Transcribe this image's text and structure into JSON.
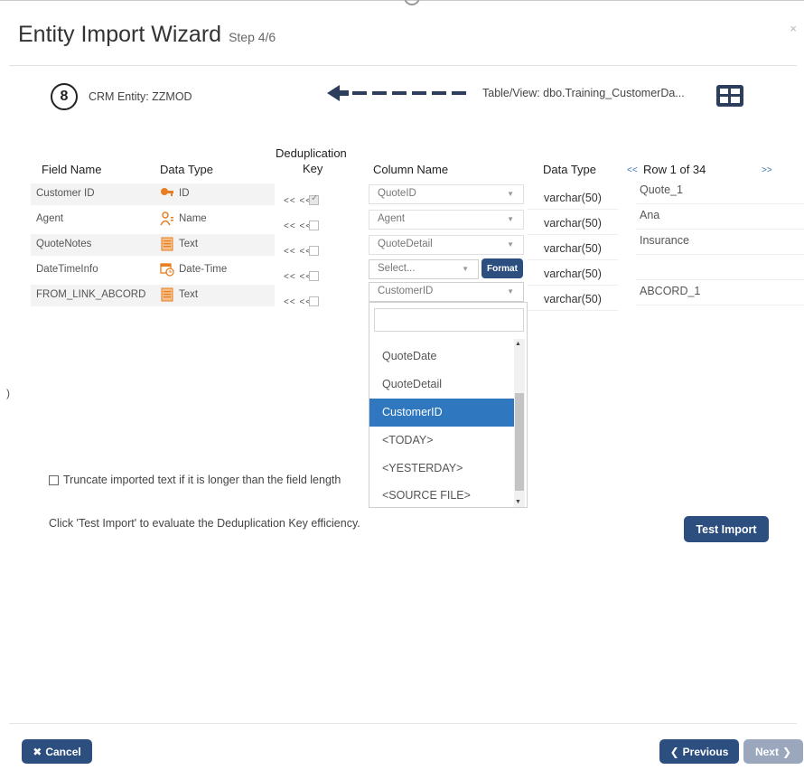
{
  "dialog": {
    "title": "Entity Import Wizard",
    "step": "Step 4/6",
    "close": "×"
  },
  "source": {
    "entity_label": "CRM Entity: ZZMOD",
    "table_label": "Table/View: dbo.Training_CustomerDa..."
  },
  "headers": {
    "field_name": "Field Name",
    "data_type": "Data Type",
    "dedup_line1": "Deduplication",
    "dedup_line2": "Key",
    "column_name": "Column Name",
    "data_type_2": "Data Type",
    "row_prev": "<<",
    "row_label": "Row 1 of 34",
    "row_next": ">>"
  },
  "rows": [
    {
      "field": "Customer ID",
      "type_icon": "key-icon",
      "type": "ID",
      "dedup_checked": true,
      "column": "QuoteID",
      "dtype": "varchar(50)",
      "value": "Quote_1"
    },
    {
      "field": "Agent",
      "type_icon": "person-name-icon",
      "type": "Name",
      "dedup_checked": false,
      "column": "Agent",
      "dtype": "varchar(50)",
      "value": "Ana"
    },
    {
      "field": "QuoteNotes",
      "type_icon": "document-text-icon",
      "type": "Text",
      "dedup_checked": false,
      "column": "QuoteDetail",
      "dtype": "varchar(50)",
      "value": "Insurance"
    },
    {
      "field": "DateTimeInfo",
      "type_icon": "calendar-clock-icon",
      "type": "Date-Time",
      "dedup_checked": false,
      "column": "Select...",
      "dtype": "varchar(50)",
      "value": ""
    },
    {
      "field": "FROM_LINK_ABCORD",
      "type_icon": "document-text-icon",
      "type": "Text",
      "dedup_checked": false,
      "column": "CustomerID",
      "dtype": "varchar(50)",
      "value": "ABCORD_1"
    }
  ],
  "arrows": "<<   <<",
  "format_button": "Format",
  "dropdown": {
    "search_value": "",
    "items": [
      "QuoteDate",
      "QuoteDetail",
      "CustomerID",
      "<TODAY>",
      "<YESTERDAY>",
      "<SOURCE FILE>"
    ],
    "selected": "CustomerID"
  },
  "truncate_label": "Truncate imported text if it is longer than the field length",
  "hint": "Click 'Test Import' to evaluate the Deduplication Key efficiency.",
  "buttons": {
    "test_import": "Test Import",
    "cancel": "Cancel",
    "previous": "Previous",
    "next": "Next"
  },
  "colors": {
    "primary_button": "#2d4f80",
    "selected_item": "#2f77bf",
    "disabled_button": "#9aa7bd",
    "key_icon": "#e67e22"
  }
}
